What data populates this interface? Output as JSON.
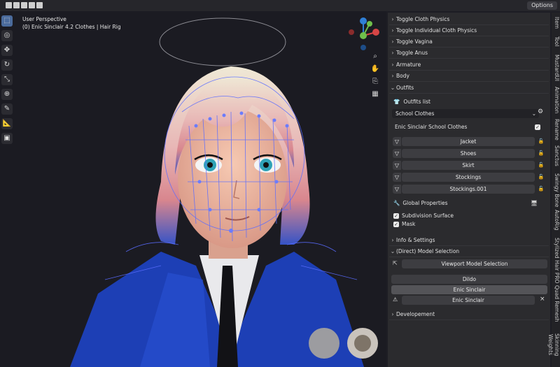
{
  "header": {
    "options_label": "Options"
  },
  "viewport": {
    "perspective": "User Perspective",
    "collection": "(0) Enic Sinclair 4.2 Clothes | Hair Rig"
  },
  "panel": {
    "sections_top": [
      "Toggle Cloth Physics",
      "Toggle Individual Cloth Physics",
      "Toggle Vagina",
      "Toggle Anus",
      "Armature",
      "Body"
    ],
    "outfits": {
      "header": "Outfits",
      "list_label": "Outfits list",
      "selected_outfit": "School Clothes",
      "collection_name": "Enic Sinclair School Clothes",
      "pieces": [
        "Jacket",
        "Shoes",
        "Skirt",
        "Stockings",
        "Stockings.001"
      ],
      "global_properties": "Global Properties",
      "subdivision": "Subdivision Surface",
      "mask": "Mask"
    },
    "info_settings": "Info & Settings",
    "model_selection": {
      "header": "(Direct) Model Selection",
      "viewport_btn": "Viewport Model Selection",
      "dildo": "Dildo",
      "enic1": "Enic Sinclair",
      "enic2": "Enic Sinclair",
      "close": "×"
    },
    "developement": "Developement"
  },
  "tabs": [
    "Item",
    "Tool",
    "MustardUI",
    "Animation",
    "Rename",
    "Sanctus",
    "Swingy Bone",
    "AutoRig",
    "Stylized Hair PRO",
    "Quad Remesh",
    "Skinning Weights"
  ],
  "gizmo": {
    "y_label": "Y",
    "x_label": "X",
    "z_label": "Z"
  }
}
